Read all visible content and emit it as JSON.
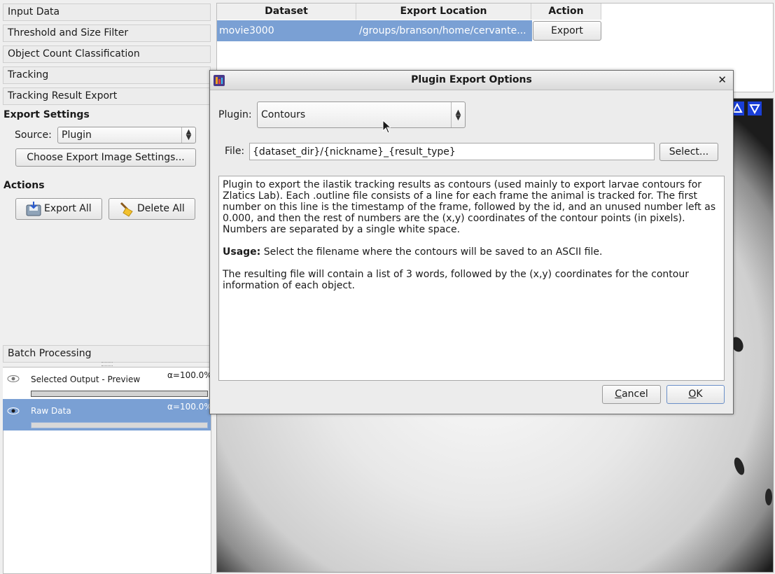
{
  "left_panel": {
    "applets": [
      "Input Data",
      "Threshold and Size Filter",
      "Object Count Classification",
      "Tracking",
      "Tracking Result Export"
    ],
    "export_settings_title": "Export Settings",
    "source_label": "Source:",
    "source_value": "Plugin",
    "choose_export_settings_button": "Choose Export Image Settings...",
    "actions_title": "Actions",
    "export_all_button": "Export All",
    "delete_all_button": "Delete All",
    "batch_processing": "Batch Processing",
    "layers": [
      {
        "name": "Selected Output - Preview",
        "opacity": "α=100.0%",
        "selected": false
      },
      {
        "name": "Raw Data",
        "opacity": "α=100.0%",
        "selected": true
      }
    ]
  },
  "table": {
    "headers": [
      "Dataset",
      "Export Location",
      "Action"
    ],
    "rows": [
      {
        "dataset": "movie3000",
        "location": "/groups/branson/home/cervante...",
        "action": "Export"
      }
    ]
  },
  "dialog": {
    "title": "Plugin Export Options",
    "plugin_label": "Plugin:",
    "plugin_value": "Contours",
    "file_label": "File:",
    "file_value": "{dataset_dir}/{nickname}_{result_type}",
    "select_button": "Select...",
    "description_p1": "Plugin to export the ilastik tracking results as contours (used mainly to export larvae contours for Zlatics Lab). Each .outline file consists of a line for each frame the animal is tracked for. The first number on this line is the timestamp of the frame, followed by the id, and an unused number left as 0.000, and then the rest of numbers are the (x,y) coordinates of the contour points (in pixels). Numbers are separated by a single white space.",
    "usage_label": "Usage:",
    "usage_text": " Select the filename where the contours will be saved to an ASCII file.",
    "description_p3": "The resulting file will contain a list of 3 words, followed by the (x,y) coordinates for the contour information of each object.",
    "cancel_button": "Cancel",
    "ok_button": "OK"
  },
  "colors": {
    "selection": "#7aa0d4",
    "accent_blue": "#1a3fd8"
  }
}
